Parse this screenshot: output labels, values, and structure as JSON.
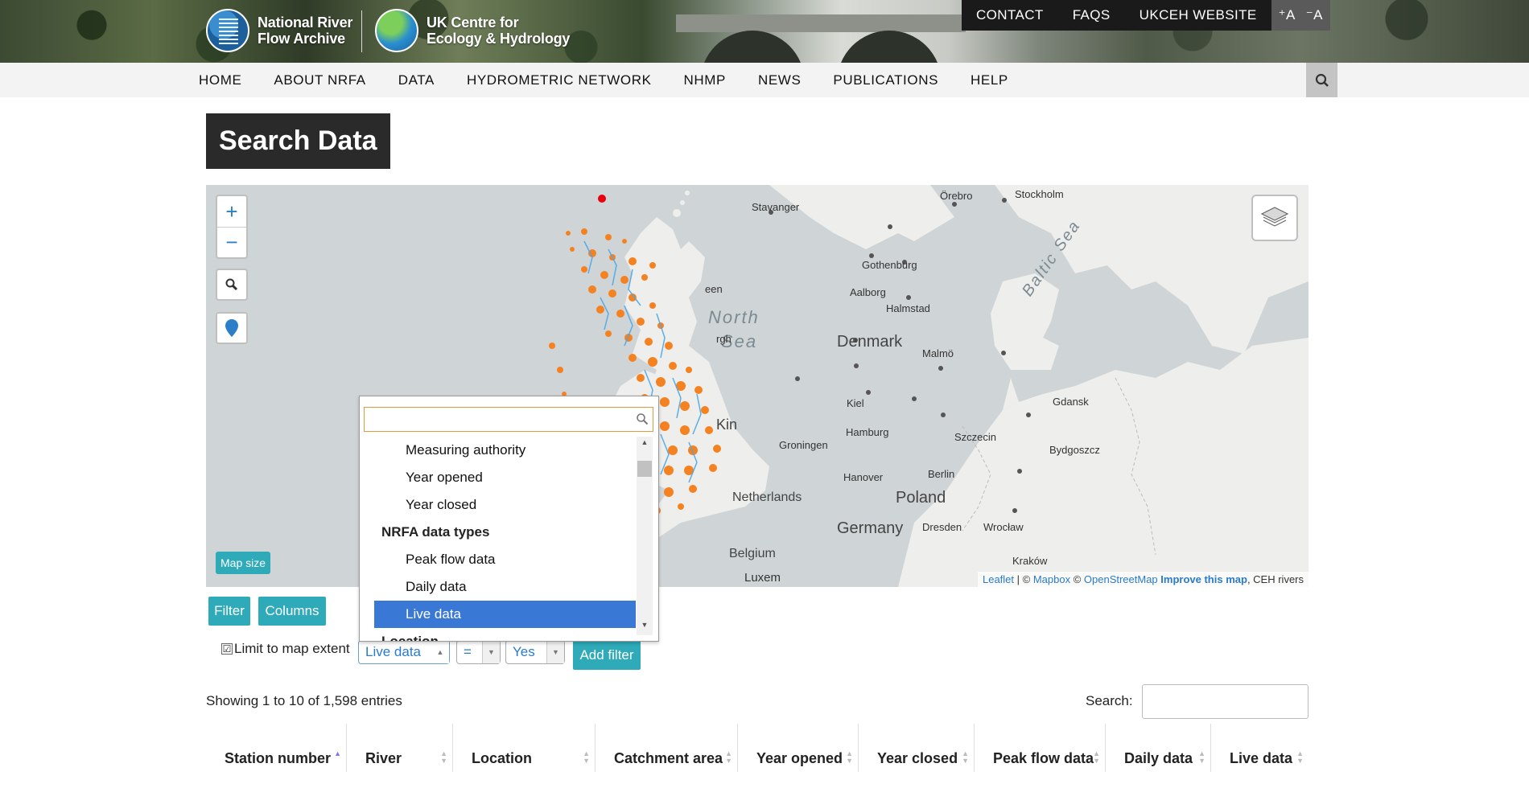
{
  "header": {
    "nrfa_line1": "National River",
    "nrfa_line2": "Flow Archive",
    "ceh_line1": "UK Centre for",
    "ceh_line2": "Ecology & Hydrology",
    "top_links": [
      "CONTACT",
      "FAQS",
      "UKCEH WEBSITE"
    ],
    "font_up": "⁺A",
    "font_down": "⁻A"
  },
  "nav": {
    "items": [
      "HOME",
      "ABOUT NRFA",
      "DATA",
      "HYDROMETRIC NETWORK",
      "NHMP",
      "NEWS",
      "PUBLICATIONS",
      "HELP"
    ],
    "search_icon": "search-icon"
  },
  "page": {
    "title": "Search Data"
  },
  "map": {
    "zoom_in": "+",
    "zoom_out": "−",
    "map_size": "Map size",
    "labels": {
      "north": "North",
      "sea": "Sea",
      "baltic": "Baltic Sea",
      "denmark": "Denmark",
      "netherlands": "Netherlands",
      "germany": "Germany",
      "poland": "Poland",
      "belgium": "Belgium",
      "luxem": "Luxem",
      "stavanger": "Stavanger",
      "orebro": "Örebro",
      "stockholm": "Stockholm",
      "gothenburg": "Gothenburg",
      "aalborg": "Aalborg",
      "halmstad": "Halmstad",
      "malmo": "Malmö",
      "kiel": "Kiel",
      "gdansk": "Gdansk",
      "hamburg": "Hamburg",
      "szczecin": "Szczecin",
      "bydgoszcz": "Bydgoszcz",
      "groningen": "Groningen",
      "hanover": "Hanover",
      "berlin": "Berlin",
      "dresden": "Dresden",
      "wroclaw": "Wrocław",
      "krakow": "Kraków",
      "kingdom": "Kin",
      "een": "een",
      "rgh": "rgh"
    },
    "attribution": {
      "leaflet": "Leaflet",
      "sep1": " | © ",
      "mapbox": "Mapbox",
      "sep2": " © ",
      "osm": "OpenStreetMap",
      "improve": "Improve this map",
      "rivers": ", CEH rivers"
    }
  },
  "controls": {
    "filter": "Filter",
    "columns": "Columns",
    "limit_label": "Limit to map extent",
    "limit_checked": "☑",
    "field_value": "Live data",
    "op_value": "=",
    "val_value": "Yes",
    "add_filter": "Add filter"
  },
  "dropdown": {
    "search_value": "",
    "items": [
      {
        "type": "item",
        "label": "Measuring authority"
      },
      {
        "type": "item",
        "label": "Year opened"
      },
      {
        "type": "item",
        "label": "Year closed"
      },
      {
        "type": "group",
        "label": "NRFA data types"
      },
      {
        "type": "item",
        "label": "Peak flow data"
      },
      {
        "type": "item",
        "label": "Daily data"
      },
      {
        "type": "item",
        "label": "Live data",
        "selected": true
      },
      {
        "type": "group",
        "label": "Location"
      }
    ]
  },
  "table": {
    "info": "Showing 1 to 10 of 1,598 entries",
    "search_label": "Search:",
    "search_value": "",
    "columns": [
      "Station number",
      "River",
      "Location",
      "Catchment area",
      "Year opened",
      "Year closed",
      "Peak flow data",
      "Daily data",
      "Live data"
    ],
    "sorted_column": "Station number",
    "sort_direction": "ascending"
  },
  "colors": {
    "accent": "#2eaab8",
    "selected": "#3a78d6",
    "station_orange": "#f58220",
    "river_blue": "#4aa8e8",
    "marker_red": "#e8000b"
  }
}
